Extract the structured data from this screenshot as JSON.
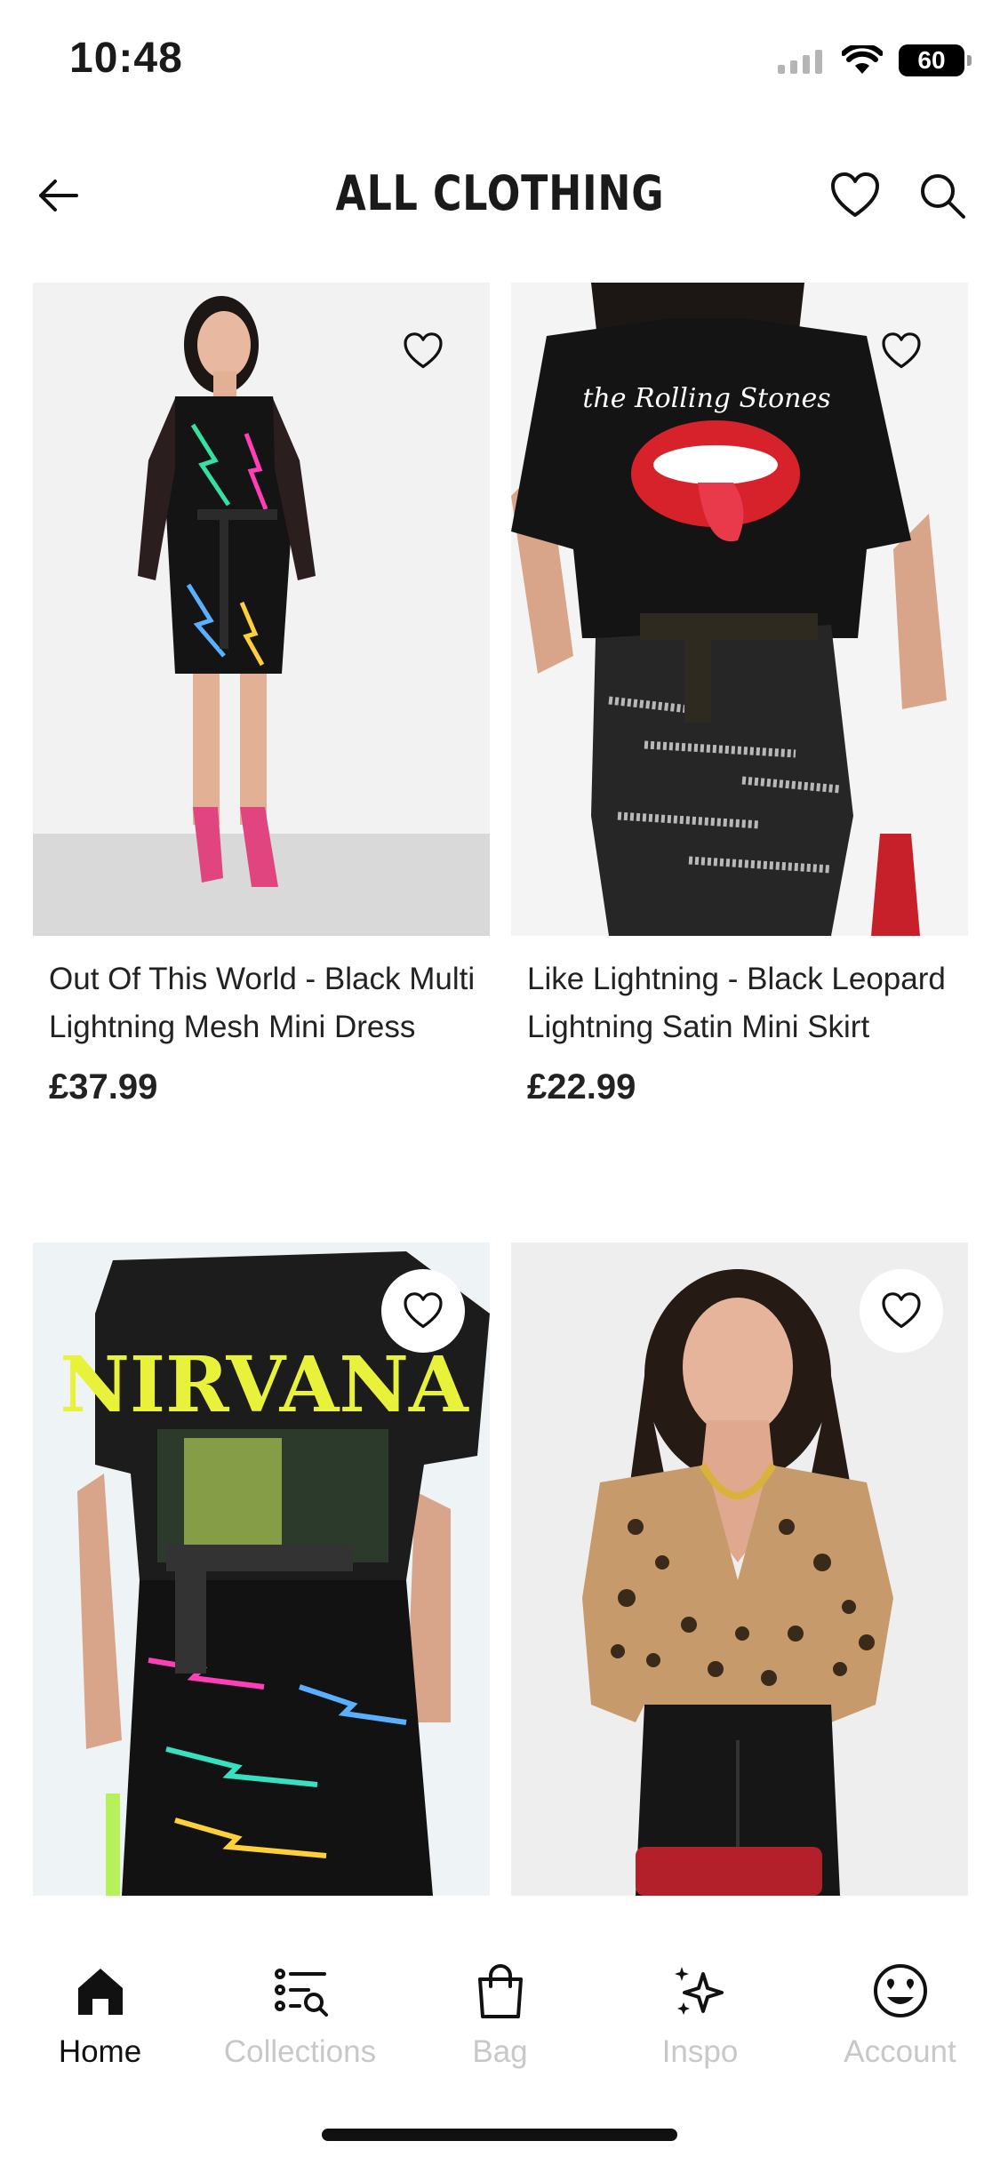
{
  "status_bar": {
    "time": "10:48",
    "battery": "60"
  },
  "header": {
    "title": "ALL CLOTHING"
  },
  "products": [
    {
      "name": "Out Of This World - Black Multi Lightning Mesh Mini Dress",
      "price": "£37.99"
    },
    {
      "name": "Like Lightning - Black Leopard Lightning Satin Mini Skirt",
      "price": "£22.99"
    },
    {
      "name": "",
      "price": ""
    },
    {
      "name": "",
      "price": ""
    }
  ],
  "image_prints": {
    "tshirt_1": "the Rolling Stones",
    "tshirt_2": "NIRVANA"
  },
  "bottom_nav": {
    "items": [
      {
        "label": "Home",
        "icon": "home-icon",
        "active": true
      },
      {
        "label": "Collections",
        "icon": "collections-icon",
        "active": false
      },
      {
        "label": "Bag",
        "icon": "bag-icon",
        "active": false
      },
      {
        "label": "Inspo",
        "icon": "sparkles-icon",
        "active": false
      },
      {
        "label": "Account",
        "icon": "smiley-icon",
        "active": false
      }
    ]
  },
  "colors": {
    "text": "#1a1a1a",
    "inactive_nav": "#c8c8c8",
    "background": "#ffffff"
  }
}
